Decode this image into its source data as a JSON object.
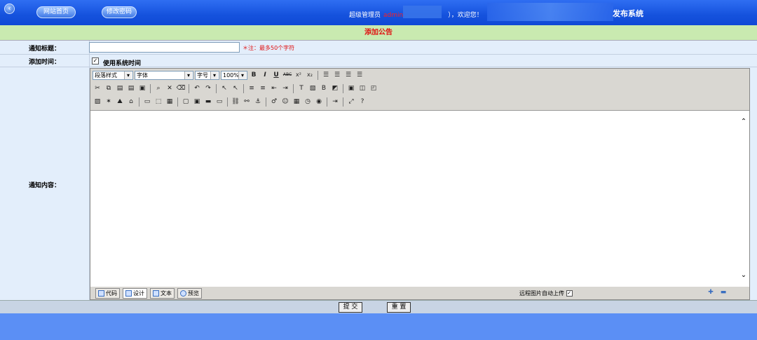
{
  "topbar": {
    "nav": [
      "网站首页",
      "修改密码"
    ],
    "welcome_prefix": "超级管理员",
    "username": "admin",
    "welcome_suffix": "），欢迎您！",
    "system_title": "发布系统"
  },
  "form": {
    "header": "添加公告",
    "title_label": "通知标题：",
    "title_value": "",
    "title_note": "＊注：最多50个字符",
    "time_label": "添加时间：",
    "use_system_time_label": "使用系统时间",
    "use_system_time_checked": true,
    "content_label": "通知内容："
  },
  "editor": {
    "format_select": "段落样式",
    "font_select": "字体",
    "size_select": "字号",
    "zoom_select": "100%",
    "mode_tabs": [
      "代码",
      "设计",
      "文本",
      "预览"
    ],
    "active_tab": "设计",
    "remote_upload_label": "远程图片自动上传",
    "remote_upload_checked": true
  },
  "buttons": {
    "submit": "提 交",
    "reset": "重 置"
  },
  "colors": {
    "topbar": "#1552dd",
    "header_bg": "#c9eab0",
    "header_text": "#e01010",
    "panel_bg": "#e3eefb",
    "page_bg": "#5b8ff5"
  }
}
